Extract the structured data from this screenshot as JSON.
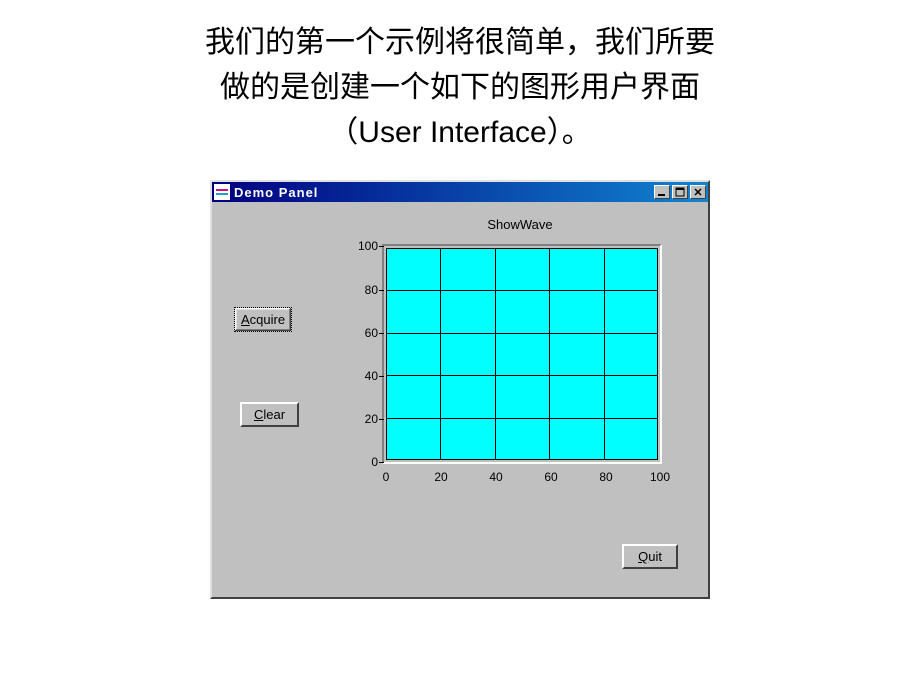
{
  "heading": {
    "line1": "我们的第一个示例将很简单，我们所要",
    "line2": "做的是创建一个如下的图形用户界面",
    "line3_prefix": "（",
    "line3_en": "User Interface",
    "line3_suffix": "）。"
  },
  "window": {
    "title": "Demo Panel"
  },
  "buttons": {
    "acquire_prefix": "A",
    "acquire_rest": "cquire",
    "clear_prefix": "C",
    "clear_rest": "lear",
    "quit_prefix": "Q",
    "quit_rest": "uit"
  },
  "chart_data": {
    "type": "scatter",
    "title": "ShowWave",
    "xlabel": "",
    "ylabel": "",
    "xlim": [
      0,
      100
    ],
    "ylim": [
      0,
      100
    ],
    "x_ticks": [
      0,
      20,
      40,
      60,
      80,
      100
    ],
    "y_ticks": [
      0,
      20,
      40,
      60,
      80,
      100
    ],
    "series": [],
    "grid": true,
    "plot_bg": "#00ffff"
  }
}
